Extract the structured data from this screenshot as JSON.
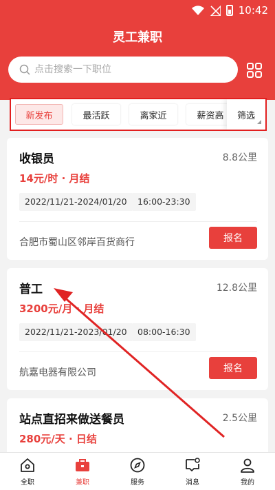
{
  "status_bar": {
    "time": "10:42"
  },
  "header": {
    "title": "灵工兼职"
  },
  "search": {
    "placeholder": "点击搜索一下职位"
  },
  "filters": {
    "chips": [
      "新发布",
      "最活跃",
      "离家近",
      "薪资高"
    ],
    "filter_label": "筛选"
  },
  "jobs": [
    {
      "title": "收银员",
      "distance": "8.8公里",
      "salary": "14元/时 · 月结",
      "date_range": "2022/11/21-2024/01/20",
      "time_range": "16:00-23:30",
      "company": "合肥市蜀山区邻岸百货商行",
      "apply_label": "报名"
    },
    {
      "title": "普工",
      "distance": "12.8公里",
      "salary": "3200元/月 · 月结",
      "date_range": "2022/11/21-2023/01/20",
      "time_range": "08:00-16:30",
      "company": "航嘉电器有限公司",
      "apply_label": "报名"
    },
    {
      "title": "站点直招来做送餐员",
      "distance": "2.5公里",
      "salary": "280元/天 · 日结"
    }
  ],
  "tabbar": [
    {
      "label": "全职",
      "icon": "home-icon"
    },
    {
      "label": "兼职",
      "icon": "briefcase-icon"
    },
    {
      "label": "服务",
      "icon": "compass-icon"
    },
    {
      "label": "消息",
      "icon": "message-icon"
    },
    {
      "label": "我的",
      "icon": "user-icon"
    }
  ],
  "colors": {
    "brand": "#e8403c",
    "highlight_border": "#e21f1f",
    "arrow": "#e02424"
  }
}
